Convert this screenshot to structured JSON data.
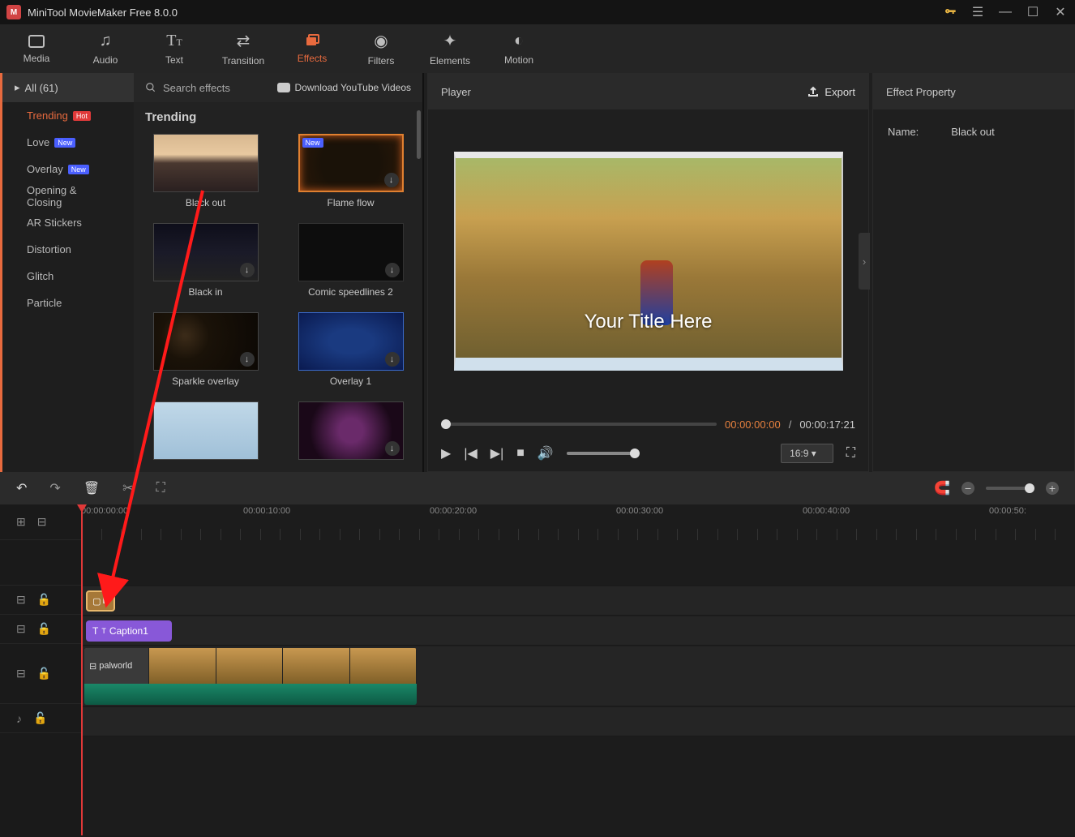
{
  "app": {
    "title": "MiniTool MovieMaker Free 8.0.0"
  },
  "mainTabs": {
    "media": "Media",
    "audio": "Audio",
    "text": "Text",
    "transition": "Transition",
    "effects": "Effects",
    "filters": "Filters",
    "elements": "Elements",
    "motion": "Motion"
  },
  "sidebar": {
    "all": "All (61)",
    "items": [
      {
        "label": "Trending",
        "badge": "Hot"
      },
      {
        "label": "Love",
        "badge": "New"
      },
      {
        "label": "Overlay",
        "badge": "New"
      },
      {
        "label": "Opening & Closing"
      },
      {
        "label": "AR Stickers"
      },
      {
        "label": "Distortion"
      },
      {
        "label": "Glitch"
      },
      {
        "label": "Particle"
      }
    ]
  },
  "effectsPanel": {
    "search": "Search effects",
    "download": "Download YouTube Videos",
    "heading": "Trending",
    "cards": [
      {
        "label": "Black out"
      },
      {
        "label": "Flame flow"
      },
      {
        "label": "Black in"
      },
      {
        "label": "Comic speedlines 2"
      },
      {
        "label": "Sparkle overlay"
      },
      {
        "label": "Overlay 1"
      }
    ]
  },
  "player": {
    "title": "Player",
    "export": "Export",
    "previewTitle": "Your Title Here",
    "timeCurrent": "00:00:00:00",
    "timeSep": " / ",
    "timeTotal": "00:00:17:21",
    "aspect": "16:9"
  },
  "props": {
    "title": "Effect Property",
    "nameLabel": "Name:",
    "nameValue": "Black out"
  },
  "ruler": {
    "t0": "00:00:00:00",
    "t1": "00:00:10:00",
    "t2": "00:00:20:00",
    "t3": "00:00:30:00",
    "t4": "00:00:40:00",
    "t5": "00:00:50:"
  },
  "clips": {
    "effect": "B",
    "caption": "Caption1",
    "video": "palworld"
  }
}
